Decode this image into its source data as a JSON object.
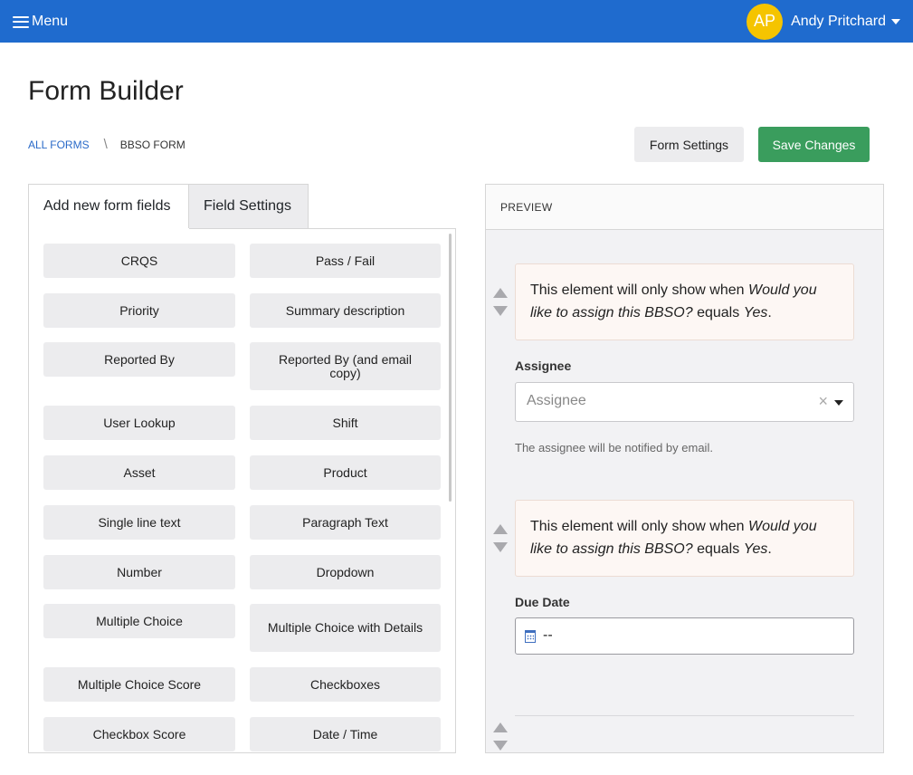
{
  "topbar": {
    "menu_label": "Menu",
    "user_initials": "AP",
    "user_name": "Andy Pritchard"
  },
  "page": {
    "title": "Form Builder"
  },
  "breadcrumb": {
    "parent": "ALL FORMS",
    "separator": "\\",
    "current": "BBSO FORM"
  },
  "actions": {
    "form_settings": "Form Settings",
    "save_changes": "Save Changes"
  },
  "tabs": {
    "add_fields": "Add new form fields",
    "field_settings": "Field Settings"
  },
  "field_types": [
    "CRQS",
    "Pass / Fail",
    "Priority",
    "Summary description",
    "Reported By",
    "Reported By (and email copy)",
    "User Lookup",
    "Shift",
    "Asset",
    "Product",
    "Single line text",
    "Paragraph Text",
    "Number",
    "Dropdown",
    "Multiple Choice",
    "Multiple Choice with Details",
    "Multiple Choice Score",
    "Checkboxes",
    "Checkbox Score",
    "Date / Time"
  ],
  "preview": {
    "header": "PREVIEW",
    "condition_prefix": "This element will only show when ",
    "condition_question": "Would you like to assign this BBSO?",
    "condition_middle": " equals ",
    "condition_value": "Yes",
    "condition_suffix": ".",
    "assignee_label": "Assignee",
    "assignee_placeholder": "Assignee",
    "clear_symbol": "×",
    "assignee_help": "The assignee will be notified by email.",
    "due_date_label": "Due Date",
    "due_date_value": "--"
  },
  "colors": {
    "topbar": "#1f6bce",
    "avatar": "#f5c400",
    "save_button": "#3a9d5d",
    "link": "#2a6ac8"
  }
}
